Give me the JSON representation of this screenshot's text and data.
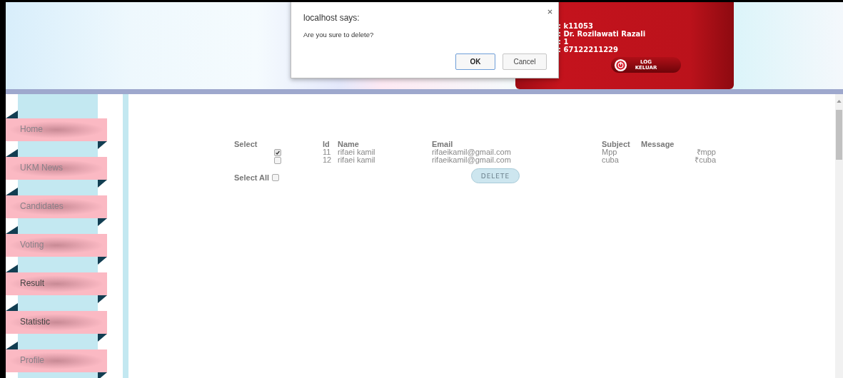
{
  "dialog": {
    "title": "localhost says:",
    "message": "Are you sure to delete?",
    "buttons": [
      {
        "label": "OK",
        "kind": "primary"
      },
      {
        "label": "Cancel",
        "kind": "secondary"
      }
    ]
  },
  "user": {
    "lines": [
      ": k11053",
      ": Dr. Rozilawati Razali",
      ": 1",
      ": 67122211229"
    ],
    "logout": "LOG KELUAR"
  },
  "sidebar": {
    "items": [
      {
        "label": "Home",
        "visited": false
      },
      {
        "label": "UKM News",
        "visited": false
      },
      {
        "label": "Candidates",
        "visited": false
      },
      {
        "label": "Voting",
        "visited": false
      },
      {
        "label": "Result",
        "visited": true
      },
      {
        "label": "Statistic",
        "visited": true
      },
      {
        "label": "Profile",
        "visited": false
      }
    ]
  },
  "table": {
    "columns": [
      "Select",
      "Id",
      "Name",
      "Email",
      "Subject",
      "Message"
    ],
    "rows": [
      {
        "checked": true,
        "id": "11",
        "name": "rifaei kamil",
        "email": "rifaeikamil@gmail.com",
        "subject": "Mpp",
        "message": "₹mpp"
      },
      {
        "checked": false,
        "id": "12",
        "name": "rifaei kamil",
        "email": "rifaeikamil@gmail.com",
        "subject": "cuba",
        "message": "₹cuba"
      }
    ],
    "select_all": {
      "label": "Select All",
      "checked": false
    },
    "delete_button": "DELETE"
  }
}
